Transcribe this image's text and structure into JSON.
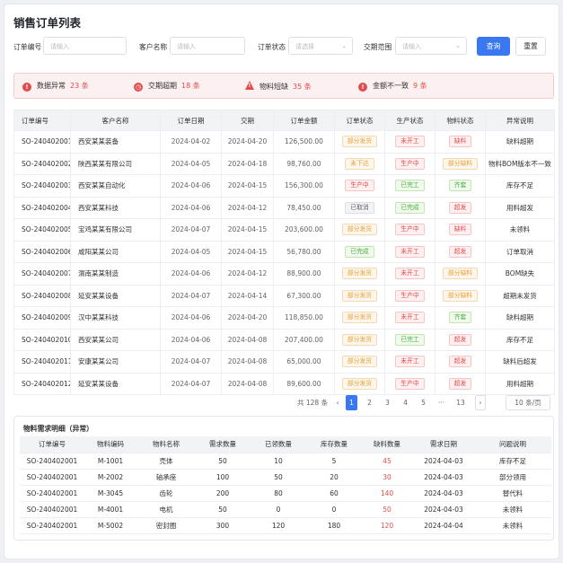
{
  "title": "销售订单列表",
  "filters": {
    "order_no_label": "订单编号",
    "order_no_placeholder": "请输入",
    "customer_label": "客户名称",
    "customer_placeholder": "请输入",
    "status_label": "订单状态",
    "status_placeholder": "请选择",
    "date_label": "交期范围",
    "date_placeholder": "请输入",
    "query_label": "查询",
    "reset_label": "重置"
  },
  "alerts": [
    {
      "icon": "alert-circle-icon",
      "label": "数据异常",
      "count": "23 条"
    },
    {
      "icon": "clock-icon",
      "label": "交期超期",
      "count": "18 条"
    },
    {
      "icon": "warning-triangle-icon",
      "label": "物料短缺",
      "count": "35 条"
    },
    {
      "icon": "alert-circle-icon",
      "label": "金额不一致",
      "count": "9 条"
    }
  ],
  "orders": {
    "columns": [
      "订单编号",
      "客户名称",
      "订单日期",
      "交期",
      "订单金额",
      "订单状态",
      "生产状态",
      "物料状态",
      "异常说明"
    ],
    "rows": [
      [
        "SO-240402001",
        "西安某某装备",
        "2024-04-02",
        "2024-04-20",
        "126,500.00",
        "部分发货",
        "未开工",
        "缺料",
        "缺料超期"
      ],
      [
        "SO-240402002",
        "陕西某某有限公司",
        "2024-04-05",
        "2024-04-18",
        "98,760.00",
        "未下达",
        "生产中",
        "部分缺料",
        "物料BOM版本不一致"
      ],
      [
        "SO-240402003",
        "西安某某自动化",
        "2024-04-06",
        "2024-04-15",
        "156,300.00",
        "生产中",
        "已完工",
        "齐套",
        "库存不足"
      ],
      [
        "SO-240402004",
        "西安某某科技",
        "2024-04-06",
        "2024-04-12",
        "78,450.00",
        "已取消",
        "已完成",
        "超发",
        "用料超发"
      ],
      [
        "SO-240402005",
        "宝鸡某某有限公司",
        "2024-04-07",
        "2024-04-15",
        "203,600.00",
        "部分发货",
        "生产中",
        "缺料",
        "未领料"
      ],
      [
        "SO-240402006",
        "咸阳某某公司",
        "2024-04-05",
        "2024-04-15",
        "56,780.00",
        "已完成",
        "未开工",
        "超发",
        "订单取消"
      ],
      [
        "SO-240402007",
        "渭南某某制造",
        "2024-04-06",
        "2024-04-12",
        "88,900.00",
        "部分发货",
        "未开工",
        "部分缺料",
        "BOM缺失"
      ],
      [
        "SO-240402008",
        "延安某某设备",
        "2024-04-07",
        "2024-04-14",
        "67,300.00",
        "部分发货",
        "生产中",
        "部分缺料",
        "超期未发货"
      ],
      [
        "SO-240402009",
        "汉中某某科技",
        "2024-04-06",
        "2024-04-20",
        "118,850.00",
        "部分发货",
        "未开工",
        "齐套",
        "缺料超期"
      ],
      [
        "SO-240402010",
        "西安某某公司",
        "2024-04-06",
        "2024-04-08",
        "207,400.00",
        "部分发货",
        "已完工",
        "超发",
        "库存不足"
      ],
      [
        "SO-240402011",
        "安康某某公司",
        "2024-04-07",
        "2024-04-08",
        "65,000.00",
        "部分发货",
        "未开工",
        "超发",
        "缺料后超发"
      ],
      [
        "SO-240402012",
        "延安某某设备",
        "2024-04-07",
        "2024-04-08",
        "89,600.00",
        "部分发货",
        "生产中",
        "超发",
        "用料超期"
      ]
    ]
  },
  "pagination": {
    "total": "共 128 条",
    "prev": "‹",
    "pages": [
      "1",
      "2",
      "3",
      "4",
      "5",
      "···",
      "13"
    ],
    "next": "›",
    "page_size": "10 条/页"
  },
  "materials": {
    "title": "物料需求明细（异常）",
    "columns": [
      "订单编号",
      "物料编码",
      "物料名称",
      "需求数量",
      "已领数量",
      "库存数量",
      "缺料数量",
      "需求日期",
      "问题说明"
    ],
    "rows": [
      [
        "SO-240402001",
        "M-1001",
        "壳体",
        "50",
        "10",
        "5",
        "45",
        "2024-04-03",
        "库存不足"
      ],
      [
        "SO-240402001",
        "M-2002",
        "轴承座",
        "100",
        "50",
        "20",
        "30",
        "2024-04-03",
        "部分领用"
      ],
      [
        "SO-240402001",
        "M-3045",
        "齿轮",
        "200",
        "80",
        "60",
        "140",
        "2024-04-03",
        "替代料"
      ],
      [
        "SO-240402001",
        "M-4001",
        "电机",
        "50",
        "0",
        "0",
        "50",
        "2024-04-03",
        "未领料"
      ],
      [
        "SO-240402001",
        "M-5002",
        "密封圈",
        "300",
        "120",
        "180",
        "120",
        "2024-04-04",
        "未领料"
      ]
    ]
  },
  "tag_colors": {
    "部分发货": "orange",
    "未下达": "orange",
    "生产中": "red",
    "已取消": "gray",
    "已完成": "green",
    "未开工": "red",
    "已完工": "green",
    "缺料": "red",
    "部分缺料": "orange",
    "齐套": "green",
    "超发": "red"
  }
}
